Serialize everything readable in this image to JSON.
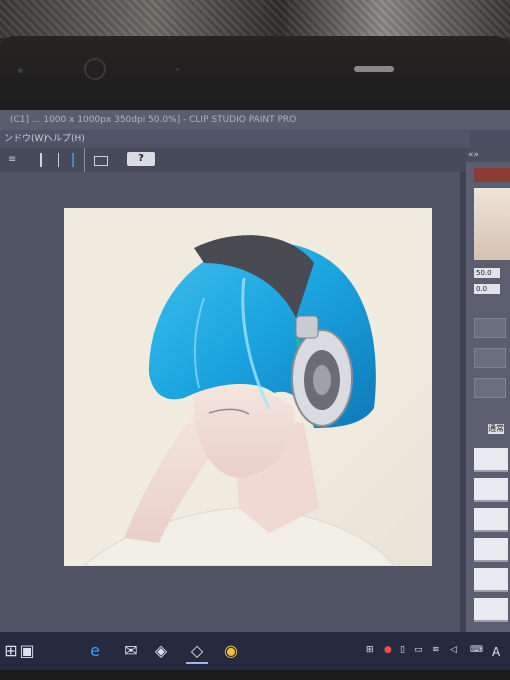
{
  "window": {
    "title": "(C1] ... 1000 x 1000px 350dpi 50.0%] - CLIP STUDIO PAINT PRO"
  },
  "menu": {
    "items": [
      "ンドウ(W)",
      "ヘルプ(H)"
    ]
  },
  "toolbar": {
    "help_label": "?"
  },
  "right_panel": {
    "collapse_label": "«»",
    "field_top": "50.0",
    "field_bottom": "0.0",
    "layer_label": "通常"
  },
  "taskbar": {
    "input_indicator": "A",
    "icons": [
      "windows-icon",
      "store-icon",
      "edge-icon",
      "mail-icon",
      "clip-studio-icon",
      "clip-studio-paint-icon",
      "chrome-icon"
    ]
  },
  "colors": {
    "hair": "#27a9e0",
    "headphone": "#d7d9de",
    "screen_ui": "#4a4e60",
    "taskbar": "#262a3e"
  }
}
